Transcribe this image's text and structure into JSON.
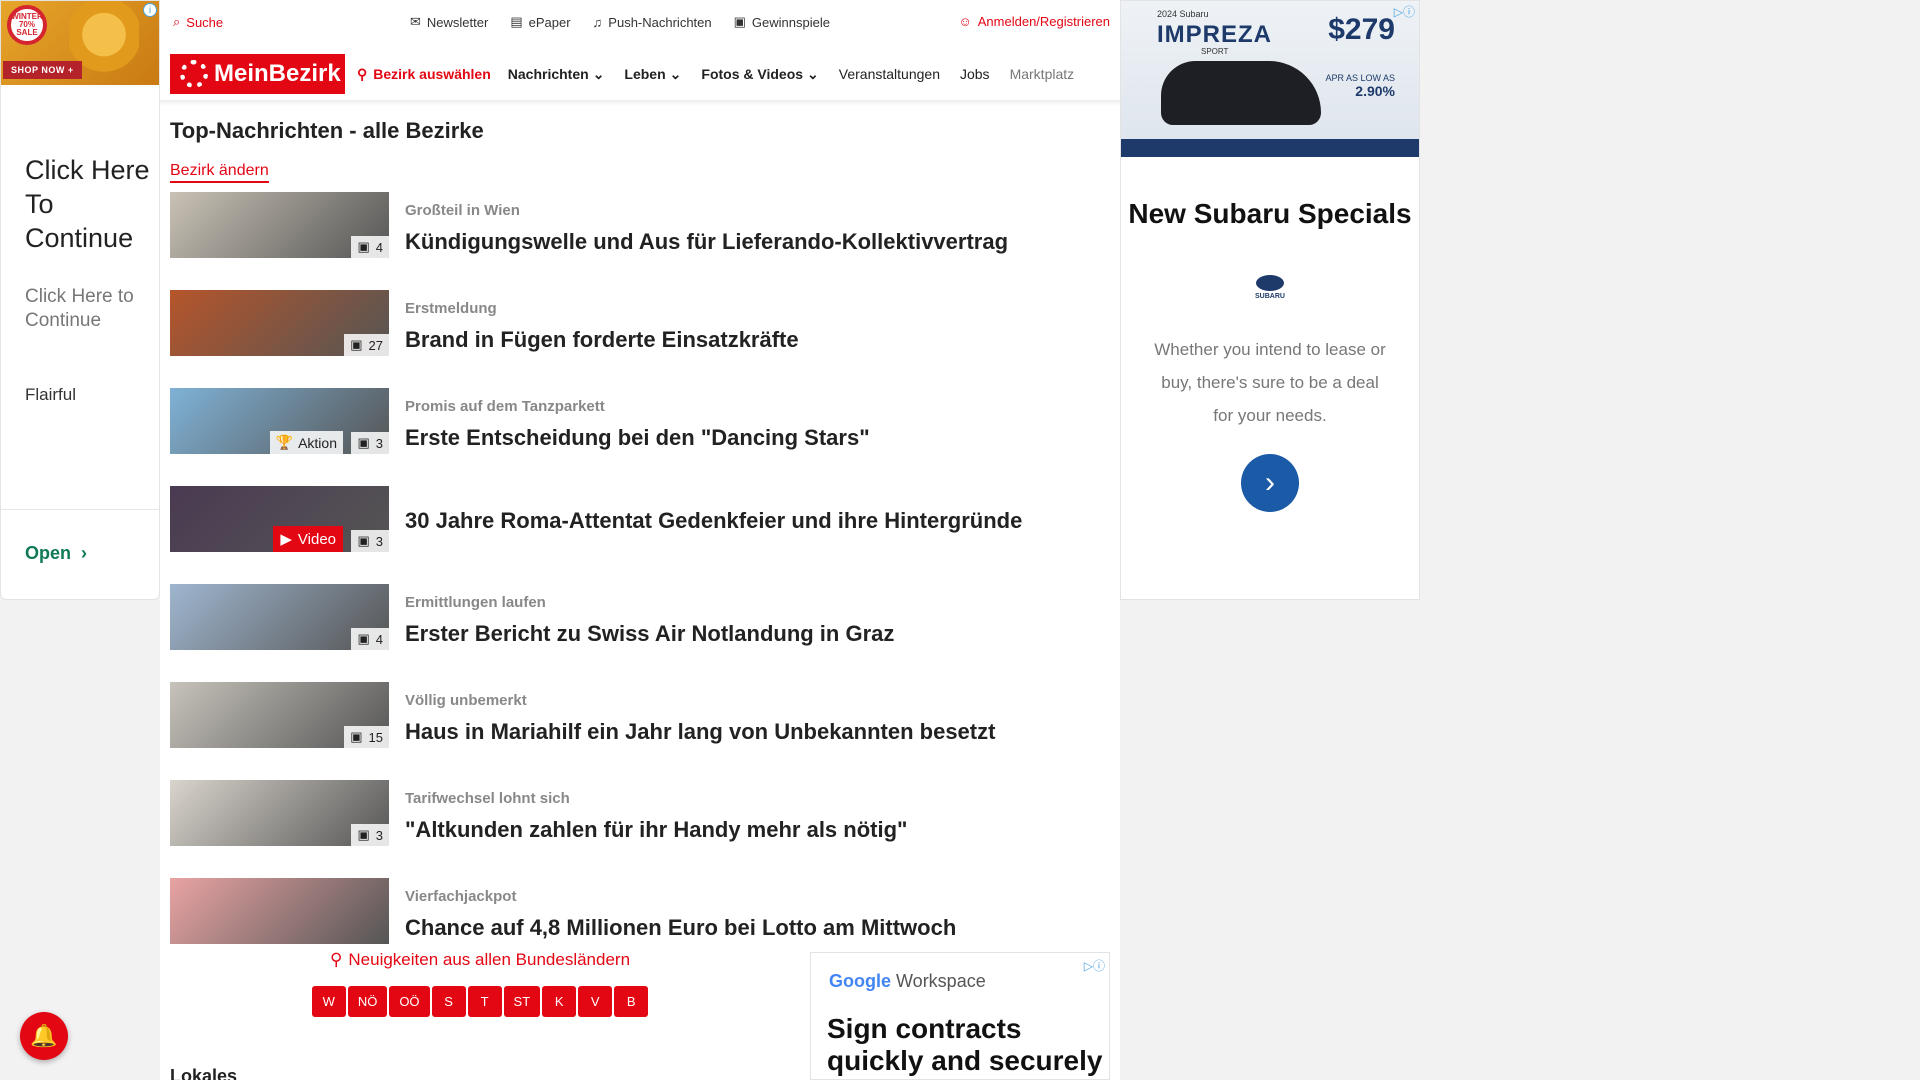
{
  "left_ad": {
    "badge": "WINTER 70% SALE",
    "shop_now": "SHOP NOW +",
    "headline": "Click Here To Continue",
    "sub": "Click Here to Continue",
    "brand": "Flairful",
    "open": "Open"
  },
  "topbar": {
    "search": "Suche",
    "newsletter": "Newsletter",
    "epaper": "ePaper",
    "push": "Push-Nachrichten",
    "gewinnspiele": "Gewinnspiele",
    "login": "Anmelden/Registrieren"
  },
  "nav": {
    "logo": "MeinBezirk",
    "bezirk": "Bezirk auswählen",
    "items": [
      "Nachrichten",
      "Leben",
      "Fotos & Videos",
      "Veranstaltungen",
      "Jobs",
      "Marktplatz"
    ]
  },
  "page": {
    "title": "Top-Nachrichten - alle Bezirke",
    "change_link": "Bezirk ändern"
  },
  "articles": [
    {
      "kicker": "Großteil in Wien",
      "title": "Kündigungswelle und Aus für Lieferando-Kollektivvertrag",
      "count": "4",
      "thumb": "#c9c2b5"
    },
    {
      "kicker": "Erstmeldung",
      "title": "Brand in Fügen forderte Einsatzkräfte",
      "count": "27",
      "thumb": "#b5552a"
    },
    {
      "kicker": "Promis auf dem Tanzparkett",
      "title": "Erste Entscheidung bei den \"Dancing Stars\"",
      "count": "3",
      "badge": "Aktion",
      "thumb": "#7fb2d6"
    },
    {
      "kicker": "",
      "title": "30 Jahre Roma-Attentat Gedenkfeier und ihre Hintergründe",
      "count": "3",
      "badge": "Video",
      "thumb": "#4a3a52"
    },
    {
      "kicker": "Ermittlungen laufen",
      "title": "Erster Bericht zu Swiss Air Notlandung in Graz",
      "count": "4",
      "thumb": "#9fb6cf"
    },
    {
      "kicker": "Völlig unbemerkt",
      "title": "Haus in Mariahilf ein Jahr lang von Unbekannten besetzt",
      "count": "15",
      "thumb": "#c7c3bb"
    },
    {
      "kicker": "Tarifwechsel lohnt sich",
      "title": "\"Altkunden zahlen für ihr Handy mehr als nötig\"",
      "count": "3",
      "thumb": "#d9d4cc"
    },
    {
      "kicker": "Vierfachjackpot",
      "title": "Chance auf 4,8 Millionen Euro bei Lotto am Mittwoch",
      "count": "",
      "thumb": "#e9a3a3"
    }
  ],
  "states": {
    "label": "Neuigkeiten aus allen Bundesländern",
    "buttons": [
      "W",
      "NÖ",
      "OÖ",
      "S",
      "T",
      "ST",
      "K",
      "V",
      "B"
    ]
  },
  "lokales": "Lokales",
  "gw_ad": {
    "brand_google": "Google",
    "brand_rest": "Workspace",
    "copy": "Sign contracts quickly and securely"
  },
  "right_ad": {
    "model": "2024 Subaru",
    "impreza": "IMPREZA",
    "sport": "SPORT",
    "price": "$279",
    "apr_label": "APR AS LOW AS",
    "rate": "2.90%",
    "headline": "New Subaru Specials",
    "logo_text": "SUBARU",
    "desc": "Whether you intend to lease or buy, there's sure to be a deal for your needs."
  }
}
